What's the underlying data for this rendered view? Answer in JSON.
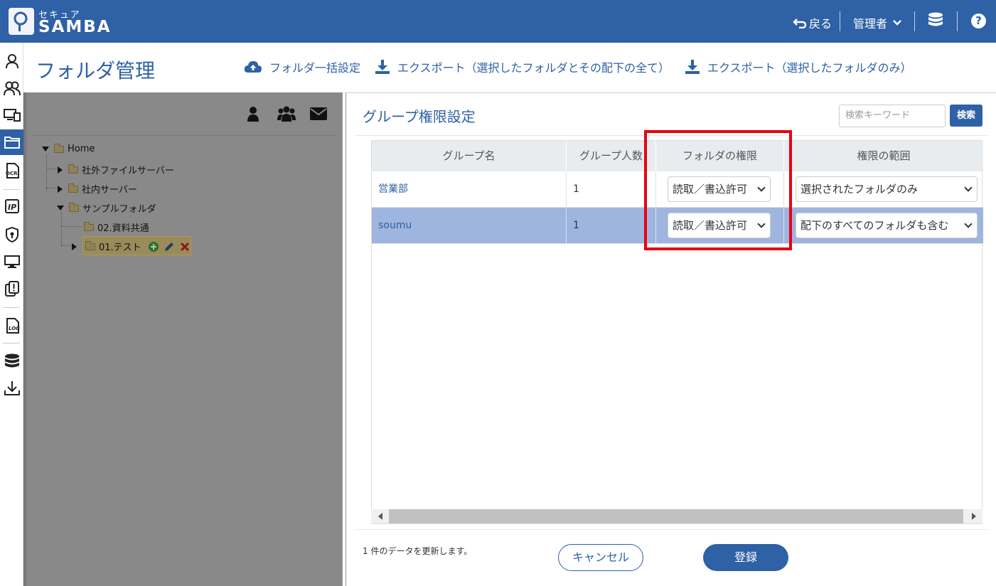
{
  "header": {
    "logo_small": "セキュア",
    "logo_big": "SAMBA",
    "back_label": "戻る",
    "admin_label": "管理者",
    "help_label": "?"
  },
  "page": {
    "title": "フォルダ管理",
    "actions": [
      {
        "label": "フォルダ一括設定",
        "icon": "cloud-upload-icon"
      },
      {
        "label": "エクスポート（選択したフォルダとその配下の全て）",
        "icon": "download-icon"
      },
      {
        "label": "エクスポート（選択したフォルダのみ）",
        "icon": "download-icon"
      }
    ]
  },
  "tree": {
    "nodes": [
      {
        "label": "Home"
      },
      {
        "label": "社外ファイルサーバー"
      },
      {
        "label": "社内サーバー"
      },
      {
        "label": "サンプルフォルダ"
      },
      {
        "label": "02.資料共通"
      },
      {
        "label": "01.テスト"
      }
    ]
  },
  "panel": {
    "title": "グループ権限設定",
    "search_placeholder": "検索キーワード",
    "search_button": "検索"
  },
  "table": {
    "headers": [
      "グループ名",
      "グループ人数",
      "フォルダの権限",
      "権限の範囲"
    ],
    "rows": [
      {
        "name": "営業部",
        "count": "1",
        "permission": "読取／書込許可",
        "scope": "選択されたフォルダのみ"
      },
      {
        "name": "soumu",
        "count": "1",
        "permission": "読取／書込許可",
        "scope": "配下のすべてのフォルダも含む"
      }
    ]
  },
  "footer": {
    "note": "1 件のデータを更新します。",
    "cancel": "キャンセル",
    "submit": "登録"
  },
  "colors": {
    "brand": "#2e61a6",
    "selected_row": "#9eb5e0",
    "highlight": "#e60012"
  }
}
